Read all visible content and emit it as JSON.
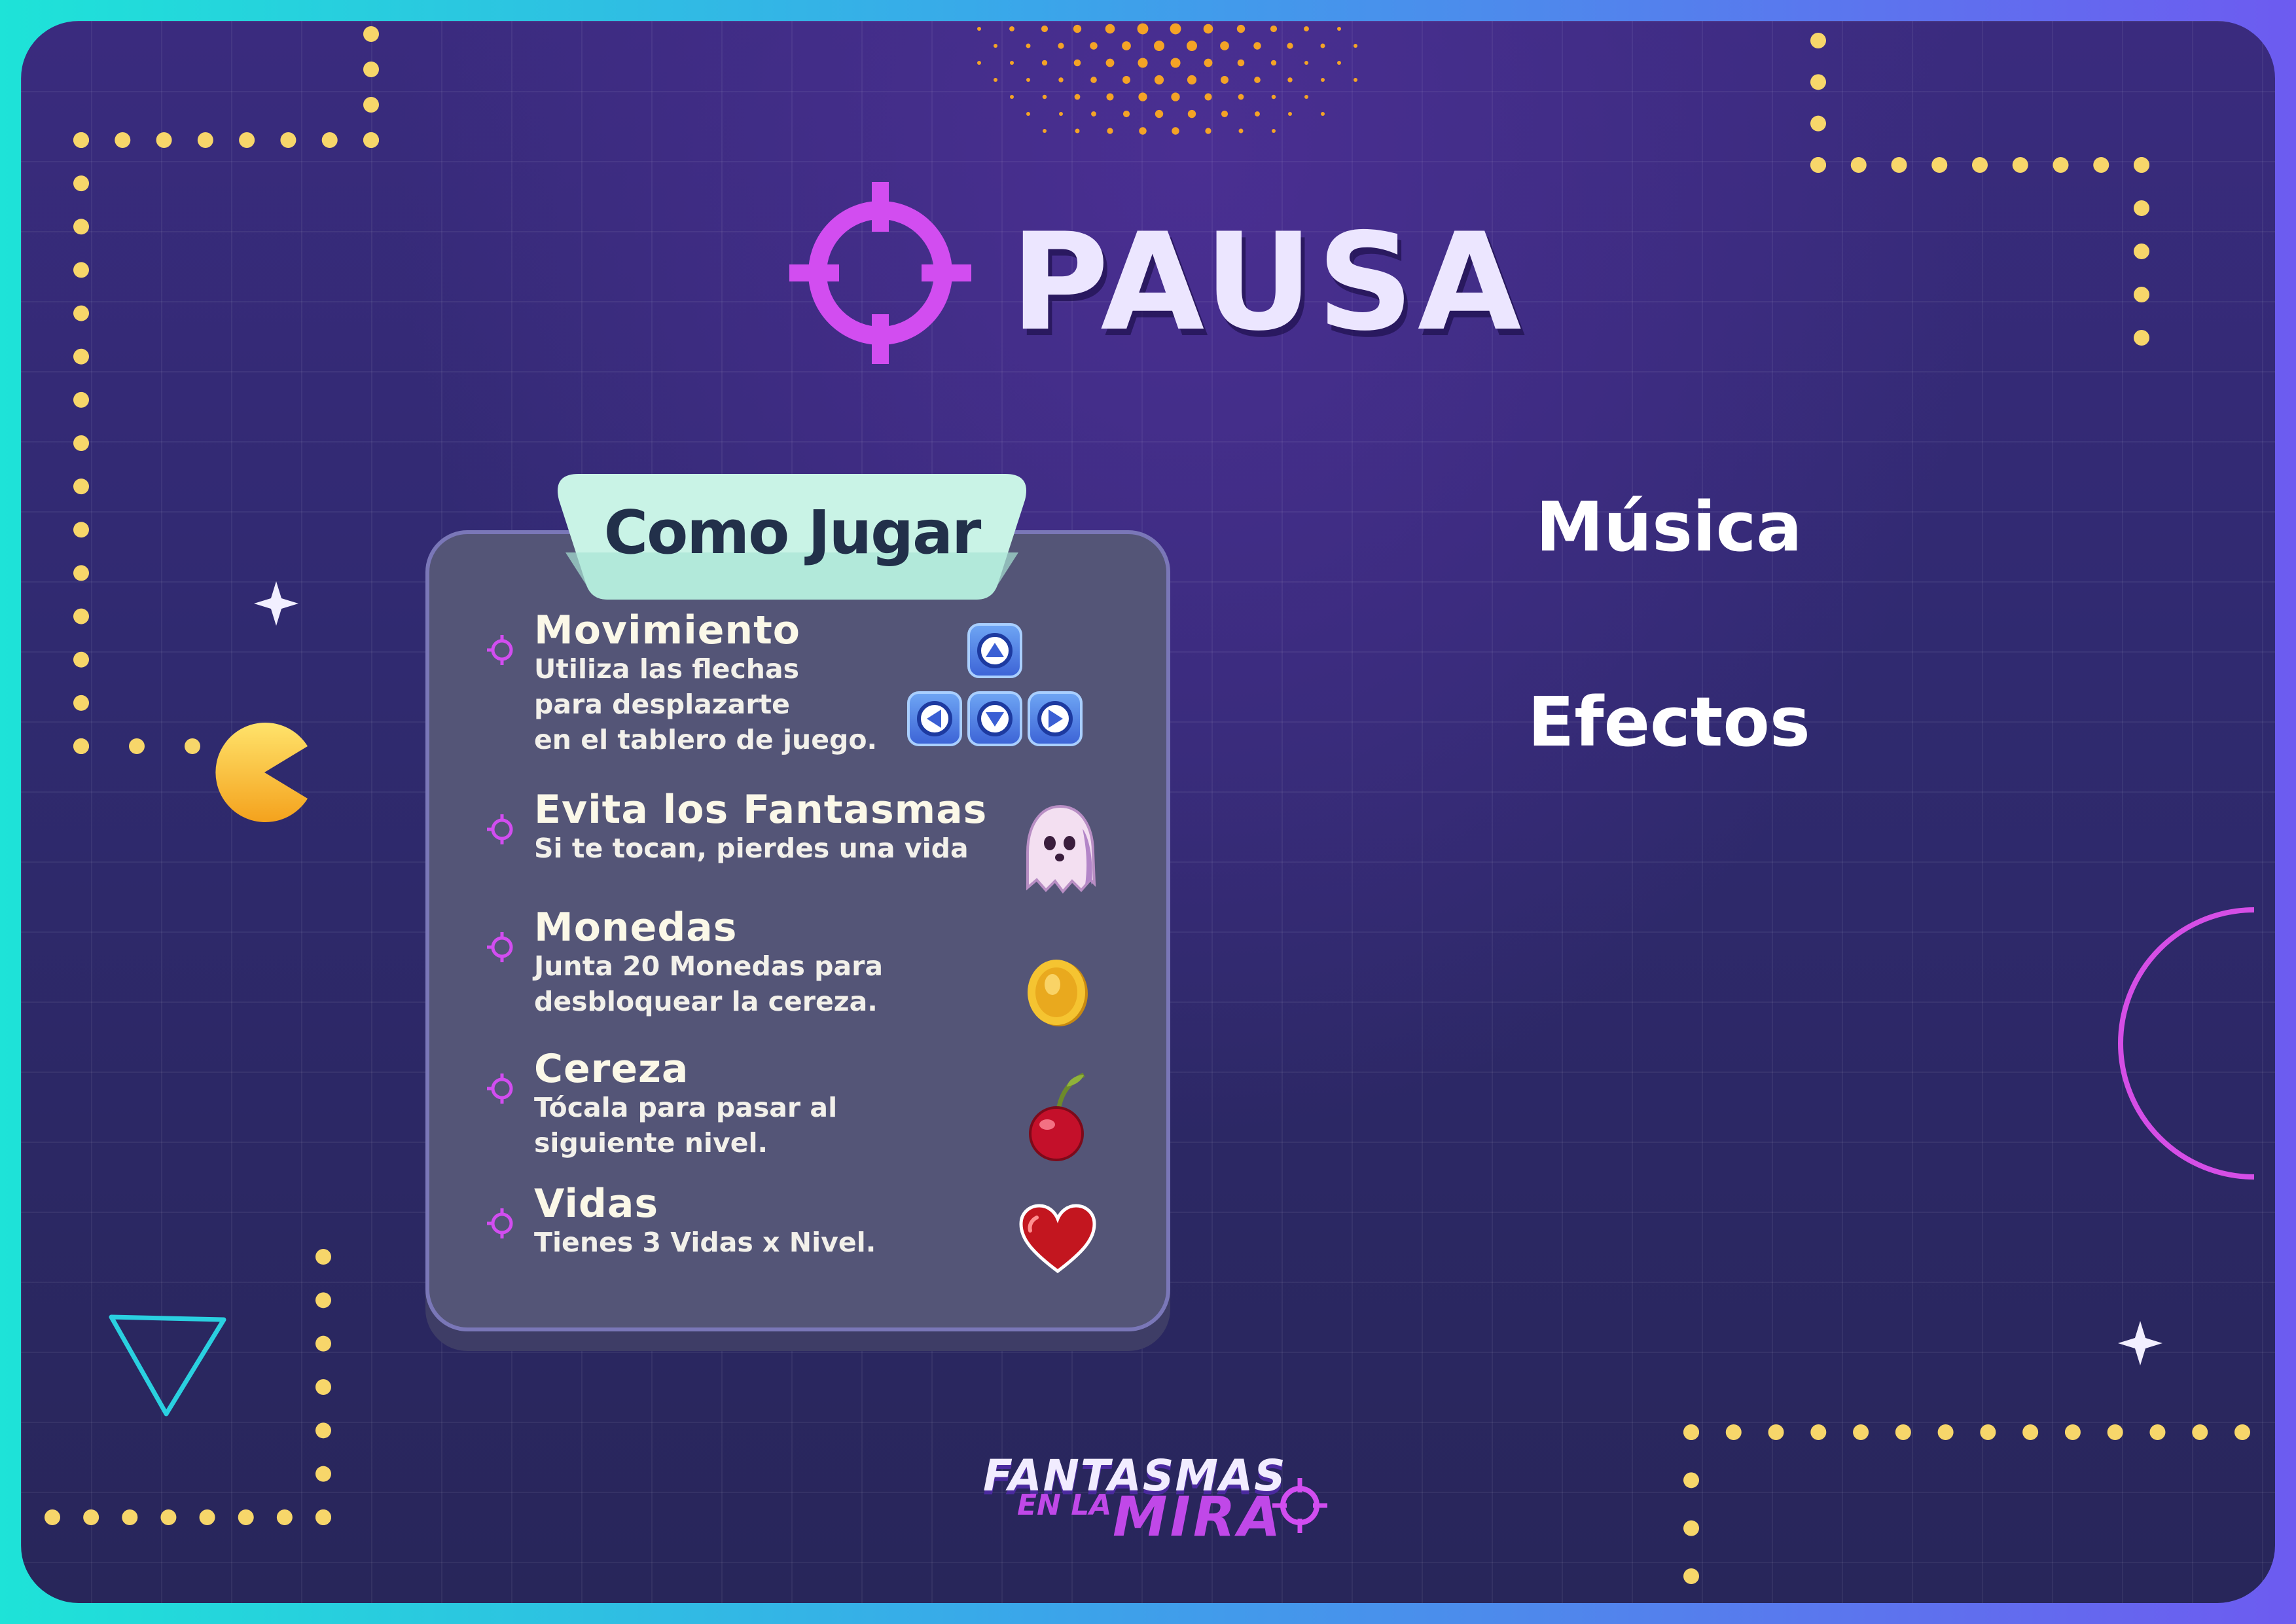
{
  "screen": {
    "title": "PAUSA"
  },
  "how_to_play": {
    "heading": "Como Jugar",
    "items": [
      {
        "title": "Movimiento",
        "description": "Utiliza las flechas\npara desplazarte\nen el tablero de juego.",
        "icon": "arrow-keys-icon"
      },
      {
        "title": "Evita los Fantasmas",
        "description": "Si te tocan, pierdes una vida",
        "icon": "ghost-icon"
      },
      {
        "title": "Monedas",
        "description": "Junta 20 Monedas para\ndesbloquear la cereza.",
        "icon": "coin-icon"
      },
      {
        "title": "Cereza",
        "description": "Tócala para pasar al\nsiguiente nivel.",
        "icon": "cherry-icon"
      },
      {
        "title": "Vidas",
        "description": "Tienes 3 Vidas x Nivel.",
        "icon": "heart-icon"
      }
    ]
  },
  "settings": {
    "music_label": "Música",
    "effects_label": "Efectos"
  },
  "logo": {
    "line1": "FANTASMAS",
    "line2": "EN LA",
    "line3": "MIRA"
  },
  "colors": {
    "accent_magenta": "#d24df0",
    "dots_yellow": "#f7d66a",
    "panel_bg": "#545577",
    "tab_mint": "#c9f3e6"
  }
}
